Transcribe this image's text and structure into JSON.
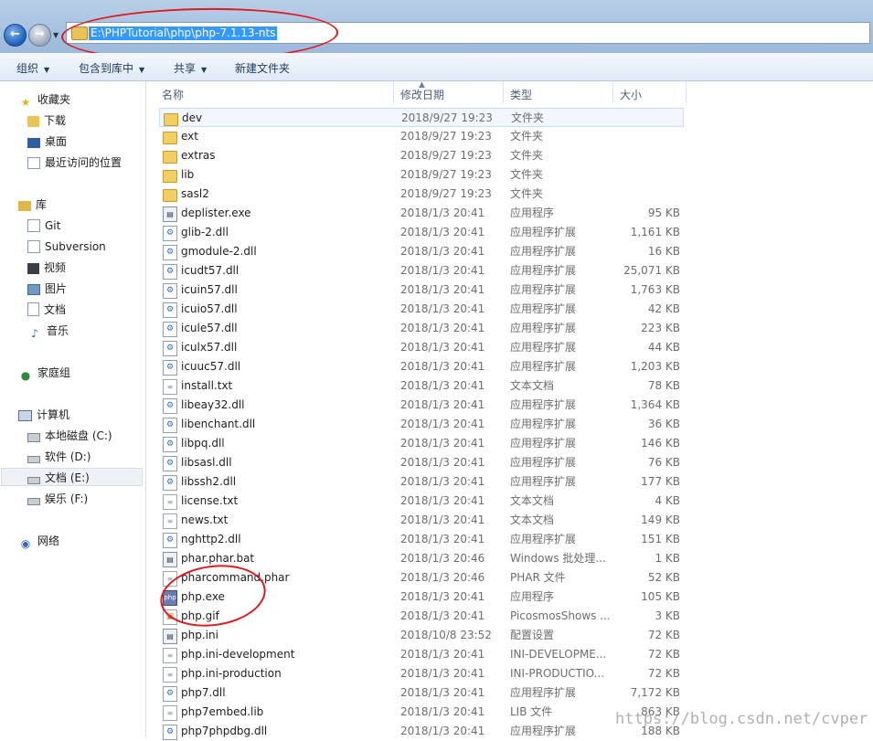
{
  "address": {
    "path": "E:\\PHPTutorial\\php\\php-7.1.13-nts"
  },
  "toolbar": {
    "organize": "组织",
    "include_in_library": "包含到库中",
    "share": "共享",
    "new_folder": "新建文件夹"
  },
  "columns": {
    "name": "名称",
    "modified": "修改日期",
    "type": "类型",
    "size": "大小"
  },
  "nav": {
    "favorites": "收藏夹",
    "downloads": "下载",
    "desktop": "桌面",
    "recent": "最近访问的位置",
    "libraries": "库",
    "git": "Git",
    "subversion": "Subversion",
    "videos": "视频",
    "pictures": "图片",
    "documents": "文档",
    "music": "音乐",
    "homegroup": "家庭组",
    "computer": "计算机",
    "drive_c": "本地磁盘 (C:)",
    "drive_d": "软件 (D:)",
    "drive_e": "文档 (E:)",
    "drive_f": "娱乐 (F:)",
    "network": "网络"
  },
  "files": [
    {
      "name": "dev",
      "date": "2018/9/27 19:23",
      "type": "文件夹",
      "size": "",
      "icon": "folder"
    },
    {
      "name": "ext",
      "date": "2018/9/27 19:23",
      "type": "文件夹",
      "size": "",
      "icon": "folder"
    },
    {
      "name": "extras",
      "date": "2018/9/27 19:23",
      "type": "文件夹",
      "size": "",
      "icon": "folder"
    },
    {
      "name": "lib",
      "date": "2018/9/27 19:23",
      "type": "文件夹",
      "size": "",
      "icon": "folder"
    },
    {
      "name": "sasl2",
      "date": "2018/9/27 19:23",
      "type": "文件夹",
      "size": "",
      "icon": "folder"
    },
    {
      "name": "deplister.exe",
      "date": "2018/1/3 20:41",
      "type": "应用程序",
      "size": "95 KB",
      "icon": "exe"
    },
    {
      "name": "glib-2.dll",
      "date": "2018/1/3 20:41",
      "type": "应用程序扩展",
      "size": "1,161 KB",
      "icon": "dll"
    },
    {
      "name": "gmodule-2.dll",
      "date": "2018/1/3 20:41",
      "type": "应用程序扩展",
      "size": "16 KB",
      "icon": "dll"
    },
    {
      "name": "icudt57.dll",
      "date": "2018/1/3 20:41",
      "type": "应用程序扩展",
      "size": "25,071 KB",
      "icon": "dll"
    },
    {
      "name": "icuin57.dll",
      "date": "2018/1/3 20:41",
      "type": "应用程序扩展",
      "size": "1,763 KB",
      "icon": "dll"
    },
    {
      "name": "icuio57.dll",
      "date": "2018/1/3 20:41",
      "type": "应用程序扩展",
      "size": "42 KB",
      "icon": "dll"
    },
    {
      "name": "icule57.dll",
      "date": "2018/1/3 20:41",
      "type": "应用程序扩展",
      "size": "223 KB",
      "icon": "dll"
    },
    {
      "name": "iculx57.dll",
      "date": "2018/1/3 20:41",
      "type": "应用程序扩展",
      "size": "44 KB",
      "icon": "dll"
    },
    {
      "name": "icuuc57.dll",
      "date": "2018/1/3 20:41",
      "type": "应用程序扩展",
      "size": "1,203 KB",
      "icon": "dll"
    },
    {
      "name": "install.txt",
      "date": "2018/1/3 20:41",
      "type": "文本文档",
      "size": "78 KB",
      "icon": "txt"
    },
    {
      "name": "libeay32.dll",
      "date": "2018/1/3 20:41",
      "type": "应用程序扩展",
      "size": "1,364 KB",
      "icon": "dll"
    },
    {
      "name": "libenchant.dll",
      "date": "2018/1/3 20:41",
      "type": "应用程序扩展",
      "size": "36 KB",
      "icon": "dll"
    },
    {
      "name": "libpq.dll",
      "date": "2018/1/3 20:41",
      "type": "应用程序扩展",
      "size": "146 KB",
      "icon": "dll"
    },
    {
      "name": "libsasl.dll",
      "date": "2018/1/3 20:41",
      "type": "应用程序扩展",
      "size": "76 KB",
      "icon": "dll"
    },
    {
      "name": "libssh2.dll",
      "date": "2018/1/3 20:41",
      "type": "应用程序扩展",
      "size": "177 KB",
      "icon": "dll"
    },
    {
      "name": "license.txt",
      "date": "2018/1/3 20:41",
      "type": "文本文档",
      "size": "4 KB",
      "icon": "txt"
    },
    {
      "name": "news.txt",
      "date": "2018/1/3 20:41",
      "type": "文本文档",
      "size": "149 KB",
      "icon": "txt"
    },
    {
      "name": "nghttp2.dll",
      "date": "2018/1/3 20:41",
      "type": "应用程序扩展",
      "size": "151 KB",
      "icon": "dll"
    },
    {
      "name": "phar.phar.bat",
      "date": "2018/1/3 20:46",
      "type": "Windows 批处理...",
      "size": "1 KB",
      "icon": "exe"
    },
    {
      "name": "pharcommand.phar",
      "date": "2018/1/3 20:46",
      "type": "PHAR 文件",
      "size": "52 KB",
      "icon": "txt"
    },
    {
      "name": "php.exe",
      "date": "2018/1/3 20:41",
      "type": "应用程序",
      "size": "105 KB",
      "icon": "php"
    },
    {
      "name": "php.gif",
      "date": "2018/1/3 20:41",
      "type": "PicosmosShows ...",
      "size": "3 KB",
      "icon": "gif"
    },
    {
      "name": "php.ini",
      "date": "2018/10/8 23:52",
      "type": "配置设置",
      "size": "72 KB",
      "icon": "exe"
    },
    {
      "name": "php.ini-development",
      "date": "2018/1/3 20:41",
      "type": "INI-DEVELOPME...",
      "size": "72 KB",
      "icon": "txt"
    },
    {
      "name": "php.ini-production",
      "date": "2018/1/3 20:41",
      "type": "INI-PRODUCTIO...",
      "size": "72 KB",
      "icon": "txt"
    },
    {
      "name": "php7.dll",
      "date": "2018/1/3 20:41",
      "type": "应用程序扩展",
      "size": "7,172 KB",
      "icon": "dll"
    },
    {
      "name": "php7embed.lib",
      "date": "2018/1/3 20:41",
      "type": "LIB 文件",
      "size": "863 KB",
      "icon": "txt"
    },
    {
      "name": "php7phpdbg.dll",
      "date": "2018/1/3 20:41",
      "type": "应用程序扩展",
      "size": "188 KB",
      "icon": "dll"
    }
  ],
  "watermark": "https://blog.csdn.net/cvper"
}
